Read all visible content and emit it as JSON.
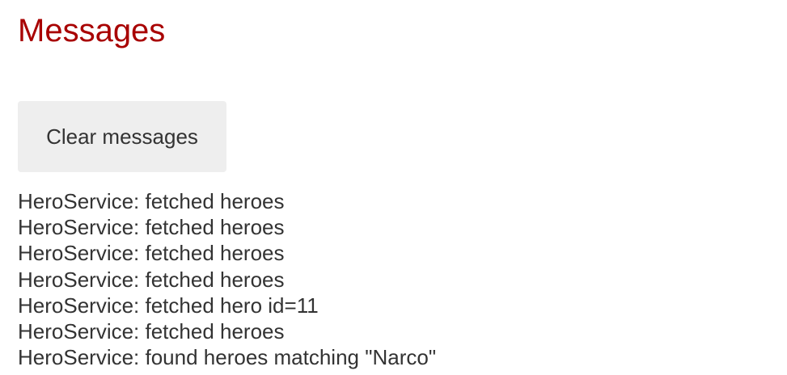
{
  "header": {
    "title": "Messages"
  },
  "actions": {
    "clear_label": "Clear messages"
  },
  "messages": [
    "HeroService: fetched heroes",
    "HeroService: fetched heroes",
    "HeroService: fetched heroes",
    "HeroService: fetched heroes",
    "HeroService: fetched hero id=11",
    "HeroService: fetched heroes",
    "HeroService: found heroes matching \"Narco\""
  ],
  "colors": {
    "title": "#a80000",
    "text": "#333333",
    "button_background": "#eeeeee",
    "page_background": "#ffffff"
  }
}
